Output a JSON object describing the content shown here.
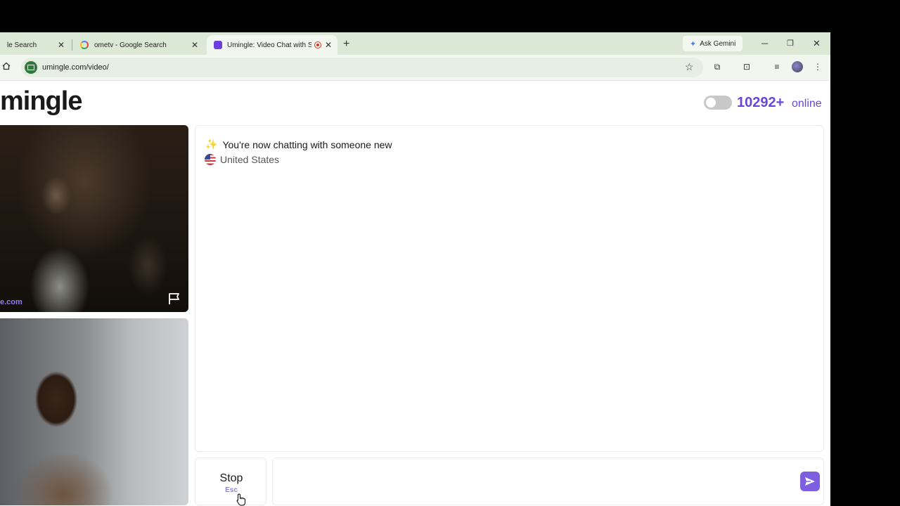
{
  "browser": {
    "tabs": [
      {
        "title": "le Search",
        "icon": "google-icon"
      },
      {
        "title": "ometv - Google Search",
        "icon": "google-icon"
      },
      {
        "title": "Umingle: Video Chat with St",
        "icon": "umingle-icon",
        "recording": true,
        "active": true
      }
    ],
    "ask_gemini_label": "Ask Gemini",
    "url": "umingle.com/video/"
  },
  "page": {
    "logo_text": "mingle",
    "online_count": "10292+",
    "online_label": "online",
    "video_watermark": "e.com",
    "chat": {
      "system_message": "You're now chatting with someone new",
      "country": "United States"
    },
    "stop_label": "Stop",
    "stop_shortcut": "Esc",
    "message_placeholder": ""
  },
  "colors": {
    "accent": "#6a47d6",
    "send_button": "#7d5fe0",
    "tab_strip": "#dbe8d6"
  }
}
